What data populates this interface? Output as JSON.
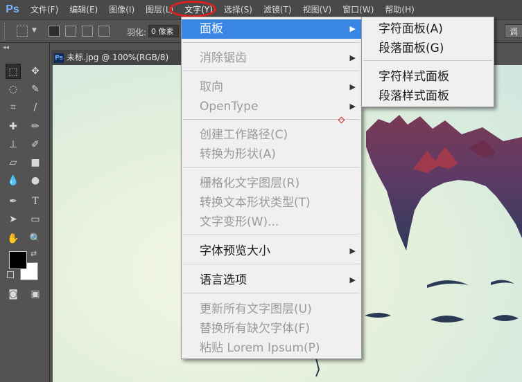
{
  "app": {
    "logo": "Ps"
  },
  "menubar": {
    "items": [
      {
        "label": "文件(F)"
      },
      {
        "label": "编辑(E)"
      },
      {
        "label": "图像(I)"
      },
      {
        "label": "图层(L)"
      },
      {
        "label": "文字(Y)"
      },
      {
        "label": "选择(S)"
      },
      {
        "label": "滤镜(T)"
      },
      {
        "label": "视图(V)"
      },
      {
        "label": "窗口(W)"
      },
      {
        "label": "帮助(H)"
      }
    ],
    "annotation_color": "#e02020"
  },
  "options_bar": {
    "feather_label": "羽化:",
    "feather_value": "0 像素",
    "adjust_button": "调整"
  },
  "document": {
    "tab_title": "未标.jpg @ 100%(RGB/8)"
  },
  "colors": {
    "foreground": "#000000",
    "background": "#ffffff",
    "highlight": "#3a86e4"
  },
  "text_menu": {
    "items": [
      {
        "label": "面板",
        "enabled": true,
        "submenu": true,
        "highlighted": true
      },
      {
        "label": "消除锯齿",
        "enabled": false,
        "submenu": true
      },
      {
        "label": "取向",
        "enabled": false,
        "submenu": true
      },
      {
        "label": "OpenType",
        "enabled": false,
        "submenu": true
      },
      {
        "label": "创建工作路径(C)",
        "enabled": false
      },
      {
        "label": "转换为形状(A)",
        "enabled": false
      },
      {
        "label": "栅格化文字图层(R)",
        "enabled": false
      },
      {
        "label": "转换文本形状类型(T)",
        "enabled": false
      },
      {
        "label": "文字变形(W)...",
        "enabled": false
      },
      {
        "label": "字体预览大小",
        "enabled": true,
        "submenu": true
      },
      {
        "label": "语言选项",
        "enabled": true,
        "submenu": true
      },
      {
        "label": "更新所有文字图层(U)",
        "enabled": false
      },
      {
        "label": "替换所有缺欠字体(F)",
        "enabled": false
      },
      {
        "label": "粘贴 Lorem Ipsum(P)",
        "enabled": false
      }
    ]
  },
  "panel_submenu": {
    "items": [
      {
        "label": "字符面板(A)"
      },
      {
        "label": "段落面板(G)"
      },
      {
        "label": "字符样式面板"
      },
      {
        "label": "段落样式面板"
      }
    ]
  },
  "icons": {
    "submenu_arrow": "chevron-right-icon"
  }
}
